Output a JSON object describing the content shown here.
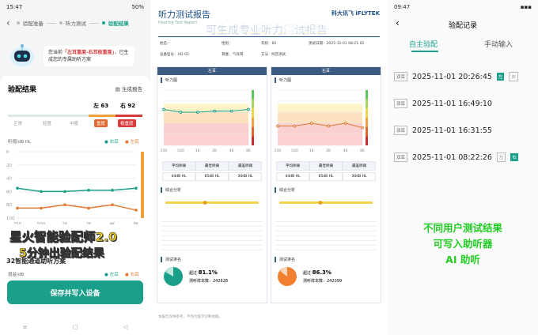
{
  "left": {
    "status": {
      "time": "15:47",
      "battery": "50%"
    },
    "nav": {
      "back": "‹",
      "steps": [
        "验配准备",
        "听力测试",
        "验配结果"
      ]
    },
    "bubble": {
      "pre": "您当前",
      "highlight": "「左耳重度-右耳极重度」",
      "post": "，已生成您的专属助听方案"
    },
    "card": {
      "title": "验配结果",
      "gen_label": "生成报告",
      "left_ear": "左 63",
      "right_ear": "右 92",
      "left_tag": "重度",
      "right_tag": "极重度",
      "scale_labels": [
        "正常",
        "轻度",
        "中度"
      ],
      "chart_unit": "听阈/dB HL",
      "legend_right": "右耳",
      "legend_left": "左耳",
      "y_ticks": [
        "0",
        "20",
        "40",
        "60",
        "80",
        "100"
      ],
      "x_ticks": [
        "250",
        "500",
        "1K",
        "2K",
        "4K",
        "8K"
      ],
      "channel_label": "32智能通道助听方案",
      "gain_label": "增益/dB",
      "legend2_right": "左耳",
      "legend2_left": "右耳",
      "save_button": "保存并写入设备"
    },
    "overlay1": "星火智能验配师2.0",
    "overlay2": "5分钟出验配结果",
    "sysnav": [
      "≡",
      "▢",
      "◁"
    ]
  },
  "chart_data": {
    "type": "line",
    "x": [
      "250",
      "500",
      "1K",
      "2K",
      "4K",
      "8K"
    ],
    "series": [
      {
        "name": "右耳",
        "values": [
          55,
          60,
          60,
          58,
          58,
          55
        ],
        "color": "#1aa08a"
      },
      {
        "name": "左耳",
        "values": [
          85,
          85,
          80,
          85,
          80,
          88
        ],
        "color": "#e0782e"
      }
    ],
    "ylim": [
      0,
      100
    ],
    "ylabel": "听阈/dB HL"
  },
  "mid": {
    "title": "听力测试报告",
    "subtitle": "Hearing Test Report",
    "caption": "可生成专业听力测试报告",
    "logo": "科大讯飞 iFLYTEK",
    "info1": "姓名：",
    "info1b": "性别：",
    "info1c": "年龄：60",
    "info1d": "测试日期：2025-11-01 08:21:02",
    "info2": "设备型号：HO-03",
    "info2b": "耳塞：",
    "info2c": "气导耳",
    "info2d": "方法：",
    "info2e": "纯音测试",
    "left_hd": "左耳",
    "right_hd": "右耳",
    "sec1": "听力图",
    "sec2": "综合分析",
    "sec3": "测试排名",
    "tbl_h": [
      "平均听阈",
      "最佳听阈",
      "最差听阈"
    ],
    "tbl_l": [
      "44dB HL",
      "65dB HL",
      "30dB HL"
    ],
    "tbl_r": [
      "44dB HL",
      "65dB HL",
      "30dB HL"
    ],
    "rank_l": "81.1%",
    "rank_r": "86.3%",
    "rank_lbl": "超过",
    "rank_total_l": "测听样本数：242628",
    "rank_total_r": "测听样本数：242099",
    "footnote": "本报告仅供参考，不作为医学诊断依据。"
  },
  "right": {
    "status": {
      "time": "09:47",
      "battery": ""
    },
    "title": "验配记录",
    "tab1": "自主验配",
    "tab2": "手动输入",
    "records": [
      {
        "ear": "双耳",
        "date": "2025-11-01 20:26:45",
        "tag1": "左",
        "tag2": "右"
      },
      {
        "ear": "双耳",
        "date": "2025-11-01 16:49:10",
        "tag1": "",
        "tag2": ""
      },
      {
        "ear": "双耳",
        "date": "2025-11-01 16:31:55",
        "tag1": "",
        "tag2": ""
      },
      {
        "ear": "双耳",
        "date": "2025-11-01 08:22:26",
        "tag1": "左",
        "tag2": "右"
      }
    ],
    "green1": "不同用户测试结果",
    "green2": "可写入助听器",
    "green3": "AI 助听"
  }
}
